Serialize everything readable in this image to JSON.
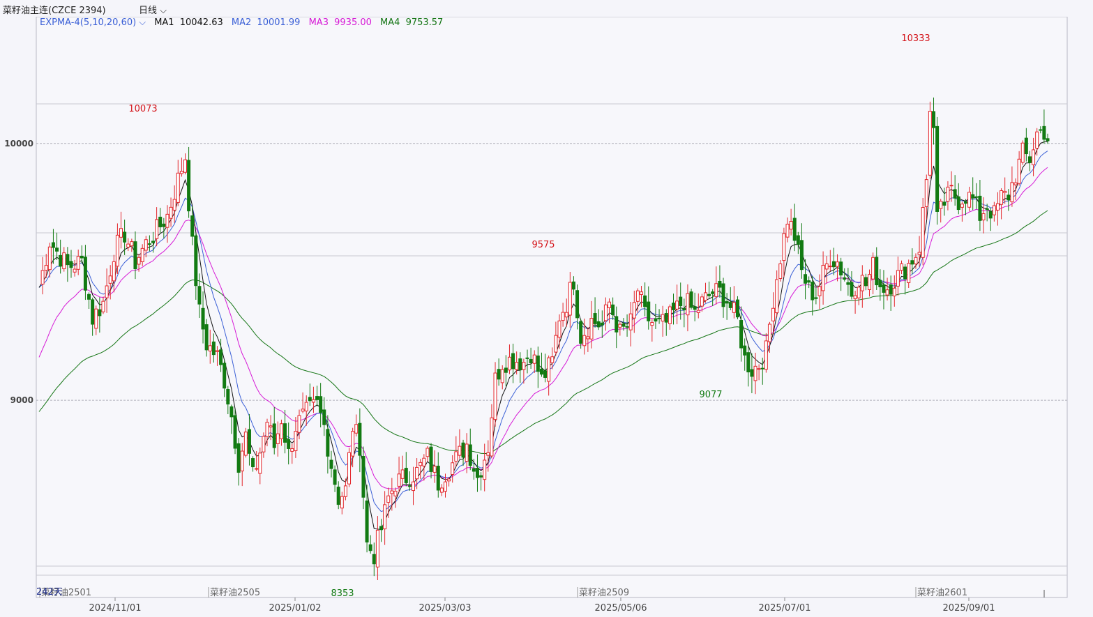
{
  "header": {
    "symbol_label": "菜籽油主连(CZCE 2394)",
    "period_label": "日线",
    "chevron_icon": "chevron-down-icon"
  },
  "legend": {
    "indicator": "EXPMA-4(5,10,20,60)",
    "ma": [
      {
        "label": "MA1",
        "value": "10042.63",
        "color": "#111111"
      },
      {
        "label": "MA2",
        "value": "10001.99",
        "color": "#3a5fd6"
      },
      {
        "label": "MA3",
        "value": "9935.00",
        "color": "#d61ad6"
      },
      {
        "label": "MA4",
        "value": "9753.57",
        "color": "#147514"
      }
    ]
  },
  "colors": {
    "up": "#e3262b",
    "down": "#127a12",
    "bg": "#f5f5fa",
    "grid": "#cfcfd6"
  },
  "chart_data": {
    "type": "candlestick",
    "ylim": [
      8300,
      10450
    ],
    "y_ticks": [
      9000,
      10000
    ],
    "x_ticks": [
      "2024/11/01",
      "2025/01/02",
      "2025/03/03",
      "2025/05/06",
      "2025/07/01",
      "2025/09/01"
    ],
    "contract_labels": [
      "菜籽油2501",
      "菜籽油2505",
      "菜籽油2509",
      "菜籽油2601"
    ],
    "day_count_label": "242天",
    "annotations": [
      {
        "text": "10073",
        "kind": "high"
      },
      {
        "text": "9575",
        "kind": "high"
      },
      {
        "text": "10333",
        "kind": "high"
      },
      {
        "text": "8353",
        "kind": "low"
      },
      {
        "text": "9077",
        "kind": "low"
      }
    ],
    "anchors": [
      [
        0,
        9440
      ],
      [
        3,
        9620
      ],
      [
        8,
        9520
      ],
      [
        12,
        9540
      ],
      [
        15,
        9320
      ],
      [
        18,
        9380
      ],
      [
        21,
        9580
      ],
      [
        24,
        9650
      ],
      [
        27,
        9540
      ],
      [
        30,
        9610
      ],
      [
        33,
        9660
      ],
      [
        36,
        9720
      ],
      [
        39,
        9860
      ],
      [
        41,
        9950
      ],
      [
        43,
        9600
      ],
      [
        45,
        9340
      ],
      [
        47,
        9220
      ],
      [
        50,
        9170
      ],
      [
        52,
        9080
      ],
      [
        54,
        8940
      ],
      [
        56,
        8760
      ],
      [
        58,
        8860
      ],
      [
        60,
        8700
      ],
      [
        62,
        8800
      ],
      [
        64,
        8920
      ],
      [
        66,
        8820
      ],
      [
        68,
        8930
      ],
      [
        70,
        8790
      ],
      [
        72,
        8900
      ],
      [
        75,
        8950
      ],
      [
        78,
        8980
      ],
      [
        80,
        8900
      ],
      [
        82,
        8750
      ],
      [
        84,
        8620
      ],
      [
        86,
        8650
      ],
      [
        88,
        8900
      ],
      [
        90,
        8830
      ],
      [
        92,
        8440
      ],
      [
        94,
        8400
      ],
      [
        96,
        8500
      ],
      [
        98,
        8620
      ],
      [
        100,
        8680
      ],
      [
        103,
        8700
      ],
      [
        106,
        8720
      ],
      [
        109,
        8780
      ],
      [
        112,
        8680
      ],
      [
        114,
        8720
      ],
      [
        117,
        8770
      ],
      [
        120,
        8830
      ],
      [
        123,
        8700
      ],
      [
        126,
        8820
      ],
      [
        128,
        9080
      ],
      [
        130,
        9150
      ],
      [
        133,
        9160
      ],
      [
        136,
        9150
      ],
      [
        138,
        9190
      ],
      [
        141,
        9080
      ],
      [
        144,
        9150
      ],
      [
        146,
        9330
      ],
      [
        148,
        9380
      ],
      [
        150,
        9470
      ],
      [
        152,
        9250
      ],
      [
        155,
        9310
      ],
      [
        158,
        9290
      ],
      [
        160,
        9380
      ],
      [
        163,
        9260
      ],
      [
        166,
        9300
      ],
      [
        168,
        9430
      ],
      [
        170,
        9330
      ],
      [
        173,
        9290
      ],
      [
        176,
        9300
      ],
      [
        178,
        9340
      ],
      [
        181,
        9390
      ],
      [
        184,
        9340
      ],
      [
        186,
        9380
      ],
      [
        189,
        9420
      ],
      [
        191,
        9420
      ],
      [
        193,
        9390
      ],
      [
        196,
        9310
      ],
      [
        198,
        9160
      ],
      [
        200,
        9120
      ],
      [
        202,
        9140
      ],
      [
        204,
        9190
      ],
      [
        206,
        9400
      ],
      [
        208,
        9560
      ],
      [
        210,
        9710
      ],
      [
        212,
        9640
      ],
      [
        214,
        9500
      ],
      [
        216,
        9430
      ],
      [
        218,
        9410
      ],
      [
        220,
        9490
      ],
      [
        222,
        9560
      ],
      [
        224,
        9540
      ],
      [
        226,
        9480
      ],
      [
        228,
        9420
      ],
      [
        230,
        9480
      ],
      [
        232,
        9450
      ],
      [
        234,
        9520
      ],
      [
        236,
        9450
      ],
      [
        238,
        9440
      ],
      [
        240,
        9470
      ],
      [
        242,
        9500
      ],
      [
        244,
        9530
      ],
      [
        246,
        9570
      ],
      [
        247,
        9600
      ],
      [
        249,
        9860
      ],
      [
        250,
        10150
      ],
      [
        251,
        10050
      ],
      [
        252,
        9700
      ],
      [
        254,
        9770
      ],
      [
        256,
        9810
      ],
      [
        258,
        9780
      ],
      [
        260,
        9800
      ],
      [
        262,
        9780
      ],
      [
        264,
        9720
      ],
      [
        266,
        9760
      ],
      [
        268,
        9720
      ],
      [
        270,
        9790
      ],
      [
        272,
        9800
      ],
      [
        274,
        9880
      ],
      [
        276,
        9960
      ],
      [
        278,
        9940
      ],
      [
        280,
        10040
      ],
      [
        282,
        10050
      ],
      [
        283,
        10020
      ]
    ]
  }
}
